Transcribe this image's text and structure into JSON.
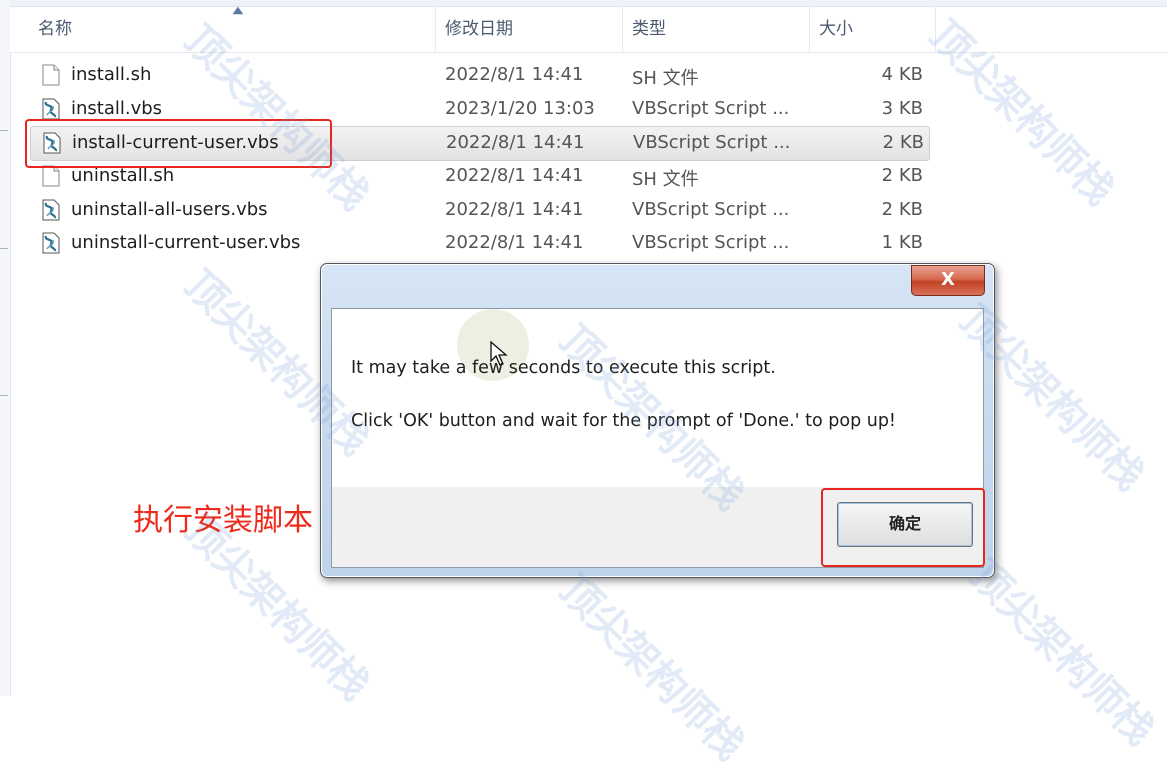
{
  "header": {
    "columns": [
      "名称",
      "修改日期",
      "类型",
      "大小"
    ]
  },
  "files": [
    {
      "name": "install.sh",
      "date": "2022/8/1 14:41",
      "type": "SH 文件",
      "size": "4 KB",
      "icon": "text-file-icon"
    },
    {
      "name": "install.vbs",
      "date": "2023/1/20 13:03",
      "type": "VBScript Script ...",
      "size": "3 KB",
      "icon": "vbscript-file-icon"
    },
    {
      "name": "install-current-user.vbs",
      "date": "2022/8/1 14:41",
      "type": "VBScript Script ...",
      "size": "2 KB",
      "icon": "vbscript-file-icon",
      "selected": true
    },
    {
      "name": "uninstall.sh",
      "date": "2022/8/1 14:41",
      "type": "SH 文件",
      "size": "2 KB",
      "icon": "text-file-icon"
    },
    {
      "name": "uninstall-all-users.vbs",
      "date": "2022/8/1 14:41",
      "type": "VBScript Script ...",
      "size": "2 KB",
      "icon": "vbscript-file-icon"
    },
    {
      "name": "uninstall-current-user.vbs",
      "date": "2022/8/1 14:41",
      "type": "VBScript Script ...",
      "size": "1 KB",
      "icon": "vbscript-file-icon"
    }
  ],
  "dialog": {
    "close_label": "X",
    "message_line1": "It may take a few seconds to execute this script.",
    "message_line2": "Click 'OK' button and wait for the prompt of 'Done.' to pop up!",
    "ok_label": "确定"
  },
  "annotation": {
    "text": "执行安装脚本",
    "color": "#e8261e"
  },
  "watermark": {
    "text": "顶尖架构师栈"
  }
}
